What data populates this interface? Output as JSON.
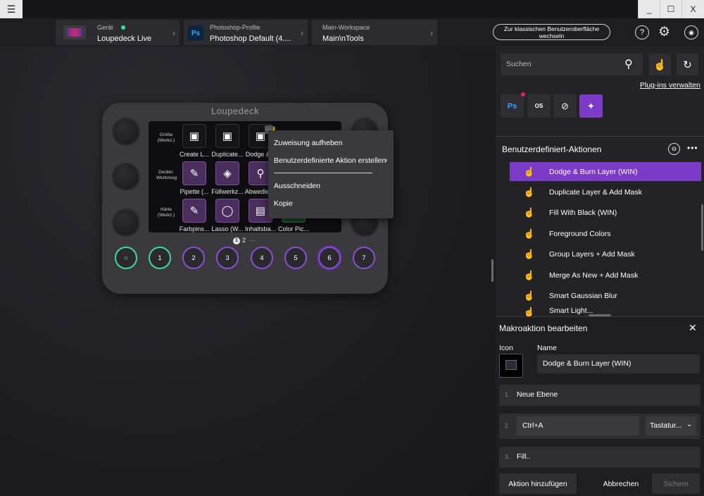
{
  "titlebar": {
    "menu_icon": "hamburger-icon",
    "minimize": "_",
    "maximize": "☐",
    "close": "X"
  },
  "header": {
    "device_label": "Gerät",
    "device_value": "Loupedeck Live",
    "profile_label": "Photoshop-Profile",
    "profile_value": "Photoshop Default (4....",
    "workspace_label": "Main-Workspace",
    "workspace_value": "Main\\nTools",
    "classic_ui_button": "Zur klassischen Benutzeroberfläche wechseln",
    "status_color": "#3ddc97"
  },
  "device": {
    "logo": "Loupedeck",
    "side_left": [
      "Größe (Werkz.)",
      "Deckkr. Werkzeug",
      "Härte (Werkz.)"
    ],
    "tiles": [
      {
        "label": "Create L...",
        "icon": "▣"
      },
      {
        "label": "Duplicate...",
        "icon": "▣"
      },
      {
        "label": "Dodge &...",
        "icon": "▣"
      },
      {
        "label": "Pipette (...",
        "icon": "✎"
      },
      {
        "label": "Füllwerkz...",
        "icon": "◈"
      },
      {
        "label": "Abwedler...",
        "icon": "⚲"
      },
      {
        "label": "Farbpins...",
        "icon": "✎"
      },
      {
        "label": "Lasso (W...",
        "icon": "◯"
      },
      {
        "label": "Inhaltsba...",
        "icon": "▤"
      },
      {
        "label": "Color Pic...",
        "icon": "◉"
      }
    ],
    "pager_current": "1",
    "pager_next": "2",
    "pager_more": "···",
    "buttons": [
      "○",
      "1",
      "2",
      "3",
      "4",
      "5",
      "6",
      "7"
    ]
  },
  "context_menu": {
    "items": [
      "Zuweisung aufheben",
      "Benutzerdefinierte Aktion erstellen",
      "Ausschneiden",
      "Kopie"
    ]
  },
  "rpanel": {
    "search_placeholder": "Suchen",
    "manage_plugins": "Plug-ins verwalten",
    "plugins": [
      "Ps",
      "OS",
      "⊘",
      "✦"
    ],
    "section_title": "Benutzerdefiniert-Aktionen",
    "list": [
      "Dodge & Burn Layer (WIN)",
      "Duplicate Layer & Add Mask",
      "Fill With Black (WIN)",
      "Foreground Colors",
      "Group Layers + Add Mask",
      "Merge As New + Add Mask",
      "Smart Gaussian Blur",
      "Smart Light..."
    ],
    "accent_color": "#7b3bc7"
  },
  "macro": {
    "title": "Makroaktion bearbeiten",
    "icon_label": "Icon",
    "name_label": "Name",
    "name_value": "Dodge & Burn Layer (WIN)",
    "steps": [
      {
        "num": "1.",
        "text": "Neue Ebene"
      },
      {
        "num": "2.",
        "text": "Ctrl+A",
        "type": "Tastatur..."
      },
      {
        "num": "3.",
        "text": "Fill.."
      }
    ],
    "add_action": "Aktion hinzufügen",
    "cancel": "Abbrechen",
    "save": "Sichern"
  }
}
